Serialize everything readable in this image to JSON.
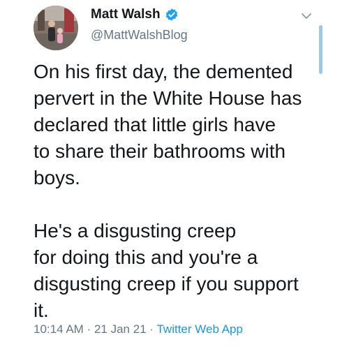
{
  "author": {
    "display_name": "Matt Walsh",
    "handle": "@MattWalshBlog",
    "verified": true
  },
  "tweet": {
    "paragraphs": [
      "On his first day, the demented\npervert in the White House has\ndeclared that little girls have\nto share their bathrooms with\nboys.",
      "He's a disgusting creep\nfor doing this and you're a\ndisgusting creep if you support\nit."
    ],
    "time": "10:14 AM",
    "date": "21 Jan 21",
    "separator": "·",
    "source": "Twitter Web App"
  },
  "icons": {
    "verified": "verified-badge-icon",
    "menu": "chevron-down-icon"
  },
  "colors": {
    "text": "#14171a",
    "secondary": "#657786",
    "accent": "#1b95e0",
    "verified": "#1da1f2"
  }
}
